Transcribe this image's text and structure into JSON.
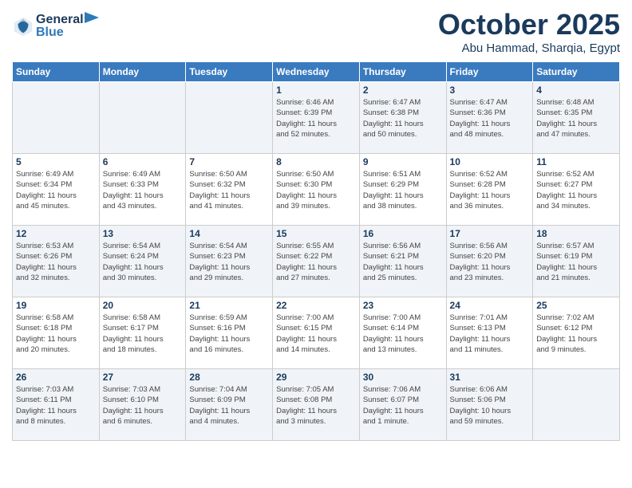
{
  "header": {
    "logo_line1": "General",
    "logo_line2": "Blue",
    "month": "October 2025",
    "location": "Abu Hammad, Sharqia, Egypt"
  },
  "weekdays": [
    "Sunday",
    "Monday",
    "Tuesday",
    "Wednesday",
    "Thursday",
    "Friday",
    "Saturday"
  ],
  "weeks": [
    [
      {
        "day": "",
        "info": ""
      },
      {
        "day": "",
        "info": ""
      },
      {
        "day": "",
        "info": ""
      },
      {
        "day": "1",
        "info": "Sunrise: 6:46 AM\nSunset: 6:39 PM\nDaylight: 11 hours\nand 52 minutes."
      },
      {
        "day": "2",
        "info": "Sunrise: 6:47 AM\nSunset: 6:38 PM\nDaylight: 11 hours\nand 50 minutes."
      },
      {
        "day": "3",
        "info": "Sunrise: 6:47 AM\nSunset: 6:36 PM\nDaylight: 11 hours\nand 48 minutes."
      },
      {
        "day": "4",
        "info": "Sunrise: 6:48 AM\nSunset: 6:35 PM\nDaylight: 11 hours\nand 47 minutes."
      }
    ],
    [
      {
        "day": "5",
        "info": "Sunrise: 6:49 AM\nSunset: 6:34 PM\nDaylight: 11 hours\nand 45 minutes."
      },
      {
        "day": "6",
        "info": "Sunrise: 6:49 AM\nSunset: 6:33 PM\nDaylight: 11 hours\nand 43 minutes."
      },
      {
        "day": "7",
        "info": "Sunrise: 6:50 AM\nSunset: 6:32 PM\nDaylight: 11 hours\nand 41 minutes."
      },
      {
        "day": "8",
        "info": "Sunrise: 6:50 AM\nSunset: 6:30 PM\nDaylight: 11 hours\nand 39 minutes."
      },
      {
        "day": "9",
        "info": "Sunrise: 6:51 AM\nSunset: 6:29 PM\nDaylight: 11 hours\nand 38 minutes."
      },
      {
        "day": "10",
        "info": "Sunrise: 6:52 AM\nSunset: 6:28 PM\nDaylight: 11 hours\nand 36 minutes."
      },
      {
        "day": "11",
        "info": "Sunrise: 6:52 AM\nSunset: 6:27 PM\nDaylight: 11 hours\nand 34 minutes."
      }
    ],
    [
      {
        "day": "12",
        "info": "Sunrise: 6:53 AM\nSunset: 6:26 PM\nDaylight: 11 hours\nand 32 minutes."
      },
      {
        "day": "13",
        "info": "Sunrise: 6:54 AM\nSunset: 6:24 PM\nDaylight: 11 hours\nand 30 minutes."
      },
      {
        "day": "14",
        "info": "Sunrise: 6:54 AM\nSunset: 6:23 PM\nDaylight: 11 hours\nand 29 minutes."
      },
      {
        "day": "15",
        "info": "Sunrise: 6:55 AM\nSunset: 6:22 PM\nDaylight: 11 hours\nand 27 minutes."
      },
      {
        "day": "16",
        "info": "Sunrise: 6:56 AM\nSunset: 6:21 PM\nDaylight: 11 hours\nand 25 minutes."
      },
      {
        "day": "17",
        "info": "Sunrise: 6:56 AM\nSunset: 6:20 PM\nDaylight: 11 hours\nand 23 minutes."
      },
      {
        "day": "18",
        "info": "Sunrise: 6:57 AM\nSunset: 6:19 PM\nDaylight: 11 hours\nand 21 minutes."
      }
    ],
    [
      {
        "day": "19",
        "info": "Sunrise: 6:58 AM\nSunset: 6:18 PM\nDaylight: 11 hours\nand 20 minutes."
      },
      {
        "day": "20",
        "info": "Sunrise: 6:58 AM\nSunset: 6:17 PM\nDaylight: 11 hours\nand 18 minutes."
      },
      {
        "day": "21",
        "info": "Sunrise: 6:59 AM\nSunset: 6:16 PM\nDaylight: 11 hours\nand 16 minutes."
      },
      {
        "day": "22",
        "info": "Sunrise: 7:00 AM\nSunset: 6:15 PM\nDaylight: 11 hours\nand 14 minutes."
      },
      {
        "day": "23",
        "info": "Sunrise: 7:00 AM\nSunset: 6:14 PM\nDaylight: 11 hours\nand 13 minutes."
      },
      {
        "day": "24",
        "info": "Sunrise: 7:01 AM\nSunset: 6:13 PM\nDaylight: 11 hours\nand 11 minutes."
      },
      {
        "day": "25",
        "info": "Sunrise: 7:02 AM\nSunset: 6:12 PM\nDaylight: 11 hours\nand 9 minutes."
      }
    ],
    [
      {
        "day": "26",
        "info": "Sunrise: 7:03 AM\nSunset: 6:11 PM\nDaylight: 11 hours\nand 8 minutes."
      },
      {
        "day": "27",
        "info": "Sunrise: 7:03 AM\nSunset: 6:10 PM\nDaylight: 11 hours\nand 6 minutes."
      },
      {
        "day": "28",
        "info": "Sunrise: 7:04 AM\nSunset: 6:09 PM\nDaylight: 11 hours\nand 4 minutes."
      },
      {
        "day": "29",
        "info": "Sunrise: 7:05 AM\nSunset: 6:08 PM\nDaylight: 11 hours\nand 3 minutes."
      },
      {
        "day": "30",
        "info": "Sunrise: 7:06 AM\nSunset: 6:07 PM\nDaylight: 11 hours\nand 1 minute."
      },
      {
        "day": "31",
        "info": "Sunrise: 6:06 AM\nSunset: 5:06 PM\nDaylight: 10 hours\nand 59 minutes."
      },
      {
        "day": "",
        "info": ""
      }
    ]
  ]
}
